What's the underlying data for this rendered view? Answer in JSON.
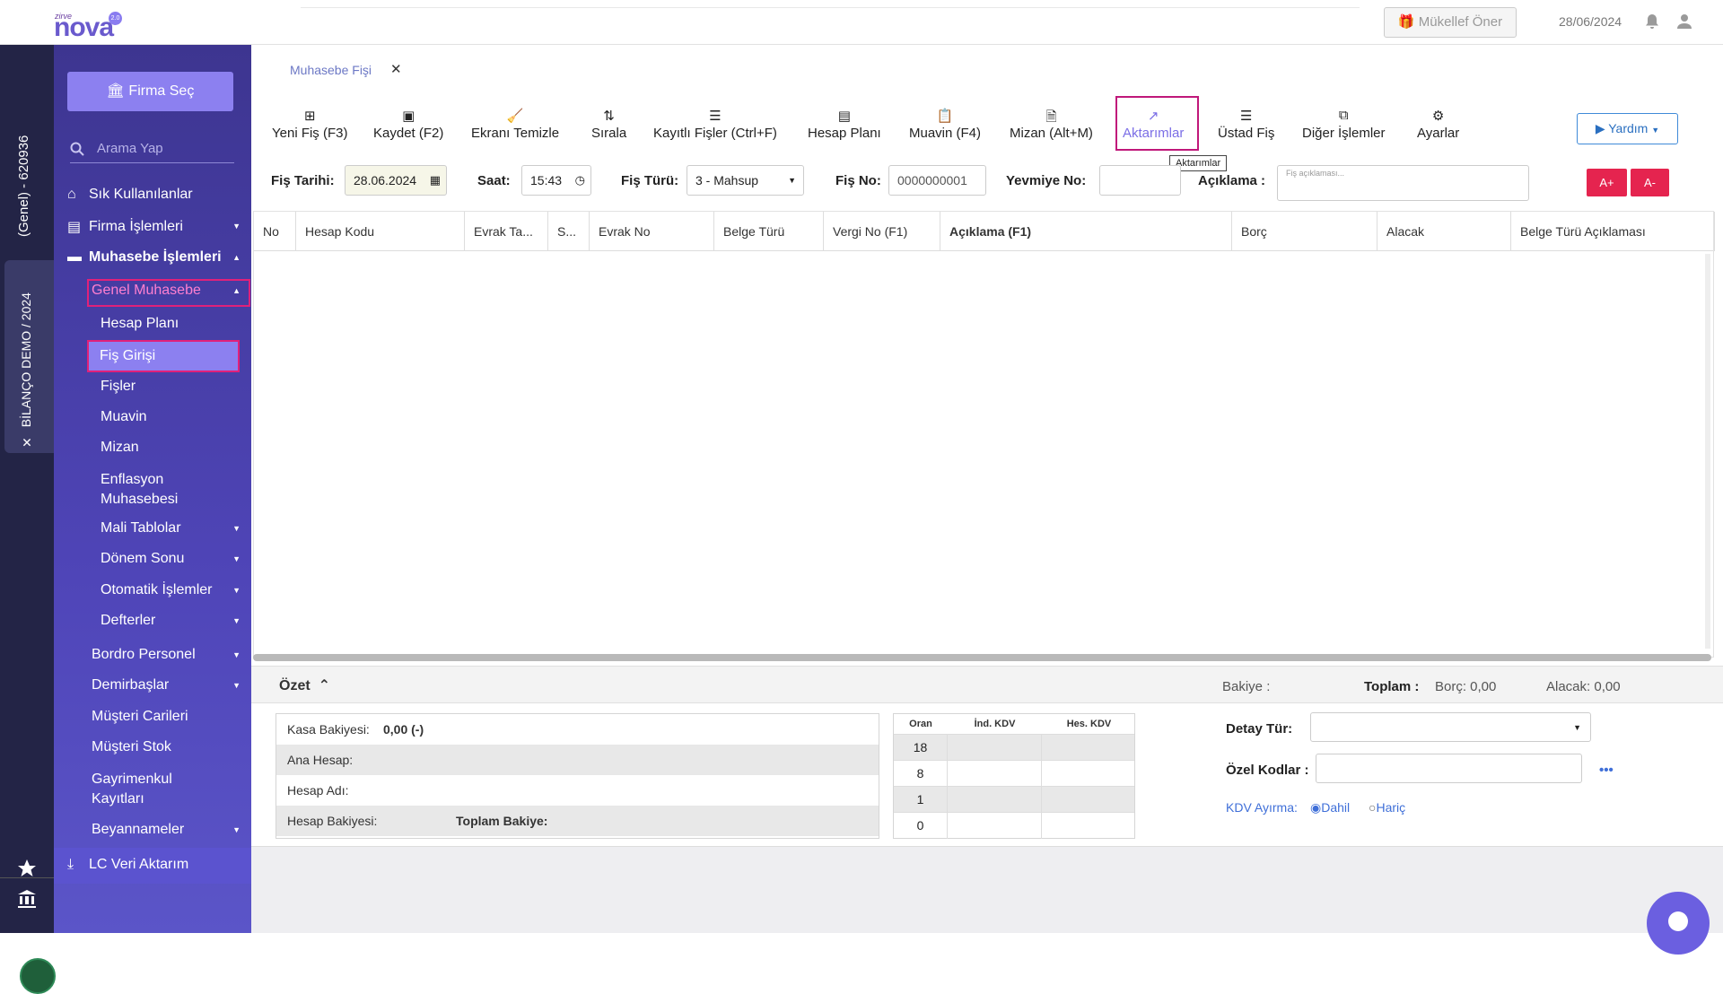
{
  "header": {
    "logo_small": "zirve",
    "logo_text": "nova",
    "logo_version": "2.0",
    "mukellef_button": "Mükellef Öner",
    "date": "28/06/2024"
  },
  "left_strip": {
    "company_code": "(Genel) - 620936",
    "company_tab": "BİLANÇO DEMO / 2024"
  },
  "sidebar": {
    "firma_sec": "Firma Seç",
    "search_placeholder": "Arama Yap",
    "items": {
      "sik": "Sık Kullanılanlar",
      "firma": "Firma İşlemleri",
      "muhasebe": "Muhasebe İşlemleri",
      "genel": "Genel Muhasebe",
      "hesap_plani": "Hesap Planı",
      "fis_girisi": "Fiş Girişi",
      "fisler": "Fişler",
      "muavin": "Muavin",
      "mizan": "Mizan",
      "enflasyon1": "Enflasyon",
      "enflasyon2": "Muhasebesi",
      "mali": "Mali Tablolar",
      "donem": "Dönem Sonu",
      "otomatik": "Otomatik İşlemler",
      "defterler": "Defterler",
      "bordro": "Bordro Personel",
      "demirbas": "Demirbaşlar",
      "musteri_cari": "Müşteri Carileri",
      "musteri_stok": "Müşteri Stok",
      "gayrimenkul1": "Gayrimenkul",
      "gayrimenkul2": "Kayıtları",
      "beyanname": "Beyannameler",
      "lc": "LC Veri Aktarım"
    }
  },
  "tab": {
    "label": "Muhasebe Fişi"
  },
  "toolbar": {
    "yeni": "Yeni Fiş (F3)",
    "kaydet": "Kaydet (F2)",
    "temizle": "Ekranı Temizle",
    "sirala": "Sırala",
    "kayitli": "Kayıtlı Fişler (Ctrl+F)",
    "hesap": "Hesap Planı",
    "muavin": "Muavin (F4)",
    "mizan": "Mizan (Alt+M)",
    "aktarimlar": "Aktarımlar",
    "ustad": "Üstad Fiş",
    "diger": "Diğer İşlemler",
    "ayarlar": "Ayarlar",
    "tooltip": "Aktarımlar",
    "yardim": "Yardım"
  },
  "form": {
    "fis_tarihi_label": "Fiş Tarihi:",
    "fis_tarihi": "28.06.2024",
    "saat_label": "Saat:",
    "saat": "15:43",
    "fis_turu_label": "Fiş Türü:",
    "fis_turu": "3 - Mahsup",
    "fis_no_label": "Fiş No:",
    "fis_no": "0000000001",
    "yevmiye_label": "Yevmiye No:",
    "yevmiye": "",
    "aciklama_label": "Açıklama :",
    "aciklama_placeholder": "Fiş açıklaması...",
    "a_plus": "A+",
    "a_minus": "A-"
  },
  "grid": {
    "columns": [
      "No",
      "Hesap Kodu",
      "Evrak Ta...",
      "S...",
      "Evrak No",
      "Belge Türü",
      "Vergi No (F1)",
      "Açıklama (F1)",
      "Borç",
      "Alacak",
      "Belge Türü Açıklaması"
    ]
  },
  "summary": {
    "ozet": "Özet",
    "bakiye_label": "Bakiye :",
    "toplam_label": "Toplam :",
    "borc": "Borç: 0,00",
    "alacak": "Alacak: 0,00",
    "kasa_label": "Kasa Bakiyesi:",
    "kasa_value": "0,00 (-)",
    "ana_hesap": "Ana Hesap:",
    "hesap_adi": "Hesap Adı:",
    "hesap_bakiyesi": "Hesap Bakiyesi:",
    "toplam_bakiye": "Toplam Bakiye:"
  },
  "kdv_table": {
    "headers": [
      "Oran",
      "İnd. KDV",
      "Hes. KDV"
    ],
    "rows": [
      "18",
      "8",
      "1",
      "0"
    ]
  },
  "right_panel": {
    "detay_label": "Detay Tür:",
    "ozel_label": "Özel Kodlar :",
    "kdv_ayirma": "KDV Ayırma:",
    "dahil": "Dahil",
    "haric": "Hariç"
  }
}
